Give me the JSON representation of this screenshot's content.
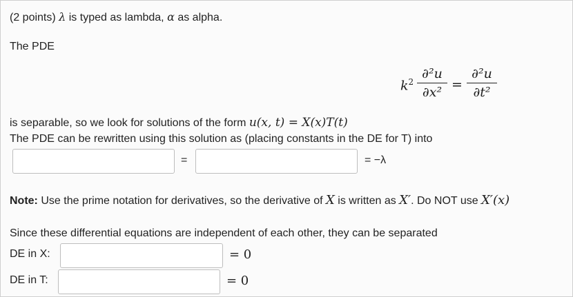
{
  "problem": {
    "points": "(2 points)",
    "lambda_sym": "λ",
    "alpha_sym": "α",
    "typed_as_lambda": "is typed as lambda,",
    "typed_as_alpha": "as alpha.",
    "pde_intro": "The PDE",
    "pde": {
      "k_sq": "k",
      "k_exp": "2",
      "lhs_num": "∂²u",
      "lhs_den": "∂x²",
      "equals": "=",
      "rhs_num": "∂²u",
      "rhs_den": "∂t²"
    },
    "separable_text": "is separable, so we look for solutions of the form",
    "solution_form": "u(x, t) = X(x)T(t)",
    "rewrite_text": "The PDE can be rewritten using this solution as (placing constants in the DE for T) into",
    "sep_equals": "=",
    "sep_rhs": "= −λ",
    "note_label": "Note:",
    "note_text_1": "Use the prime notation for derivatives, so the derivative of",
    "note_X": "X",
    "note_text_2": "is written as",
    "note_Xprime": "X′",
    "note_text_3": ". Do NOT use",
    "note_Xprimex": "X′(x)",
    "independent_text": "Since these differential equations are independent of each other, they can be separated",
    "de_x_label": "DE in X:",
    "de_x_rhs": "= 0",
    "de_t_label": "DE in T:",
    "de_t_rhs": "= 0"
  },
  "inputs": {
    "sep_left": "",
    "sep_right": "",
    "de_x": "",
    "de_t": ""
  }
}
